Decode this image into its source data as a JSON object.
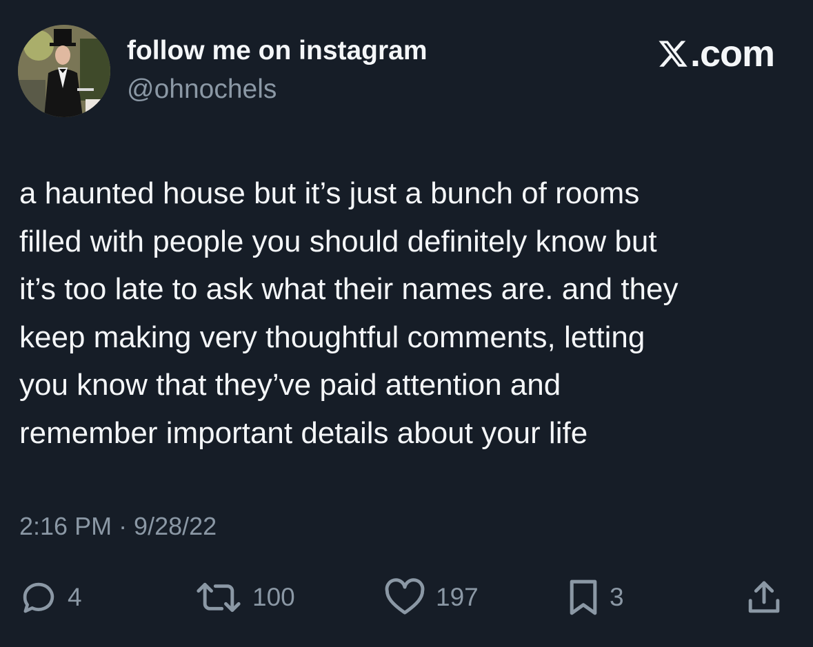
{
  "author": {
    "display_name": "follow me on instagram",
    "handle": "@ohnochels"
  },
  "brand": {
    "name": ".com",
    "logo_icon": "x-logo-icon"
  },
  "tweet": {
    "lines": [
      "a haunted house but it’s just a bunch of rooms",
      "filled with people you should definitely know but",
      "it’s too late to ask what their names are. and they",
      "keep making very thoughtful comments, letting",
      "you know that they’ve paid attention and",
      "remember important details about your life"
    ],
    "timestamp": "2:16 PM · 9/28/22"
  },
  "actions": {
    "replies": "4",
    "reposts": "100",
    "likes": "197",
    "bookmarks": "3"
  },
  "colors": {
    "background": "#161d27",
    "text": "#f4f6f8",
    "muted": "#8b98a5"
  }
}
